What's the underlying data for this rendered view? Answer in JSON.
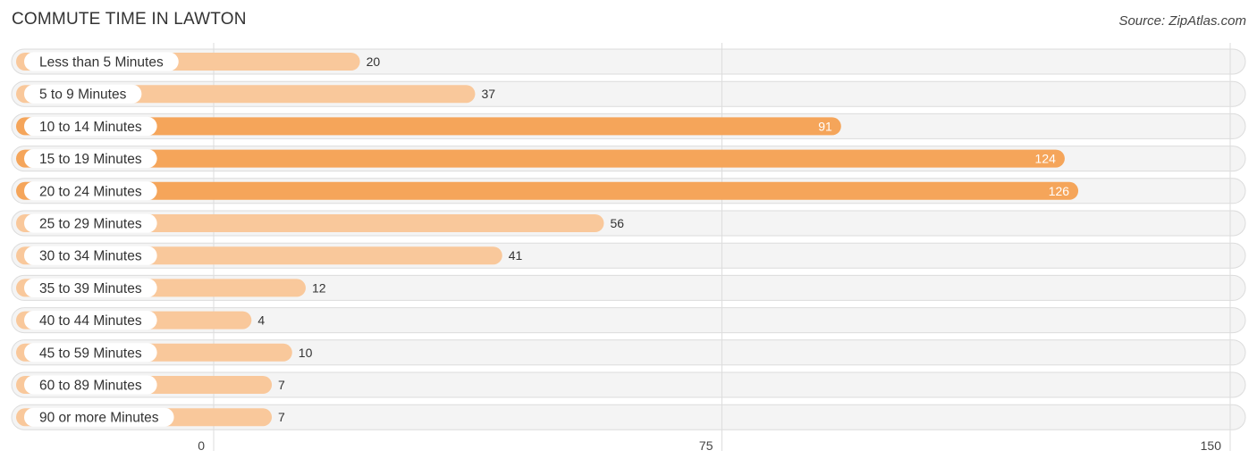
{
  "header": {
    "title": "COMMUTE TIME IN LAWTON",
    "source": "Source: ZipAtlas.com"
  },
  "colors": {
    "bar_light": "#f9c89b",
    "bar_dark": "#f5a55a",
    "track": "#f4f4f4",
    "value_inside": "#ffffff",
    "value_outside": "#333333"
  },
  "chart_data": {
    "type": "bar",
    "orientation": "horizontal",
    "title": "COMMUTE TIME IN LAWTON",
    "xlabel": "",
    "ylabel": "",
    "categories": [
      "Less than 5 Minutes",
      "5 to 9 Minutes",
      "10 to 14 Minutes",
      "15 to 19 Minutes",
      "20 to 24 Minutes",
      "25 to 29 Minutes",
      "30 to 34 Minutes",
      "35 to 39 Minutes",
      "40 to 44 Minutes",
      "45 to 59 Minutes",
      "60 to 89 Minutes",
      "90 or more Minutes"
    ],
    "values": [
      20,
      37,
      91,
      124,
      126,
      56,
      41,
      12,
      4,
      10,
      7,
      7
    ],
    "xlim": [
      0,
      150
    ],
    "ticks": [
      0,
      75,
      150
    ],
    "tick_labels": [
      "0",
      "75",
      "150"
    ],
    "grid": true,
    "legend": "none"
  }
}
